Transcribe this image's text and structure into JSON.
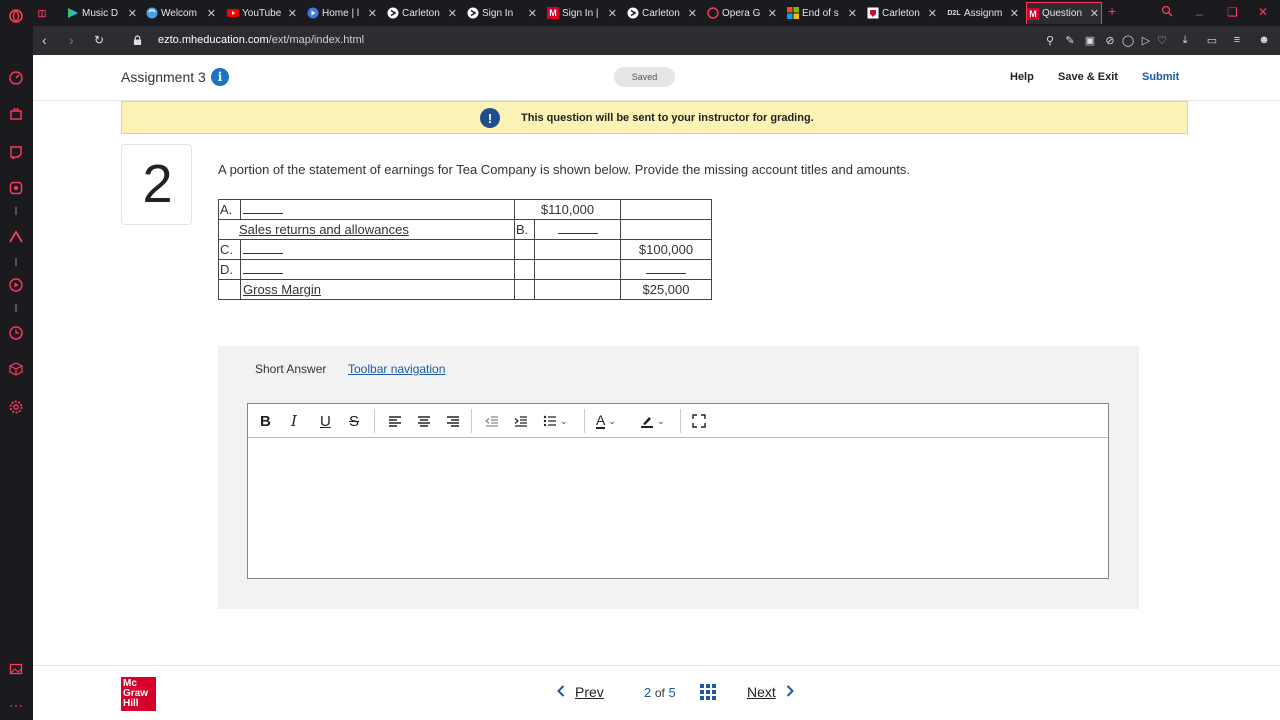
{
  "browser": {
    "tabs": [
      {
        "icon": "play-store-icon",
        "label": "Music D"
      },
      {
        "icon": "welcome-icon",
        "label": "Welcom"
      },
      {
        "icon": "youtube-icon",
        "label": "YouTube"
      },
      {
        "icon": "home-icon",
        "label": "Home | l"
      },
      {
        "icon": "carleton-icon",
        "label": "Carleton"
      },
      {
        "icon": "signin-icon",
        "label": "Sign In"
      },
      {
        "icon": "mheducation-icon",
        "label": "Sign In |"
      },
      {
        "icon": "carleton-icon",
        "label": "Carleton"
      },
      {
        "icon": "opera-gx-icon",
        "label": "Opera G"
      },
      {
        "icon": "microsoft-icon",
        "label": "End of s"
      },
      {
        "icon": "carleton-crest-icon",
        "label": "Carleton"
      },
      {
        "icon": "d2l-icon",
        "label": "Assignm"
      },
      {
        "icon": "mheducation-icon",
        "label": "Question"
      }
    ],
    "url_domain": "ezto.mheducation.com",
    "url_path": "/ext/map/index.html"
  },
  "header": {
    "assignment_title": "Assignment 3",
    "saved_label": "Saved",
    "help_label": "Help",
    "save_exit_label": "Save & Exit",
    "submit_label": "Submit"
  },
  "banner": {
    "text": "This question will be sent to your instructor for grading."
  },
  "question": {
    "number": "2",
    "prompt": "A portion of the statement of earnings for Tea Company is shown below. Provide the missing account titles and amounts.",
    "rows": [
      {
        "label": "A.",
        "name": "",
        "mid": "",
        "amount1": "$110,000",
        "amount2": ""
      },
      {
        "label": "",
        "name": "Sales returns and allowances",
        "mid": "B.",
        "amount1": "",
        "amount2": ""
      },
      {
        "label": "C.",
        "name": "",
        "mid": "",
        "amount1": "",
        "amount2": "$100,000"
      },
      {
        "label": "D.",
        "name": "",
        "mid": "",
        "amount1": "",
        "amount2": ""
      },
      {
        "label": "",
        "name": "Gross Margin",
        "mid": "",
        "amount1": "",
        "amount2": "$25,000"
      }
    ]
  },
  "answer": {
    "type_label": "Short Answer",
    "toolbar_nav_label": "Toolbar navigation",
    "toolbar": {
      "bold": "B",
      "italic": "I",
      "underline": "U",
      "strike": "S",
      "font_color": "A"
    }
  },
  "footer": {
    "logo_line1": "Mc",
    "logo_line2": "Graw",
    "logo_line3": "Hill",
    "prev_label": "Prev",
    "current_page": "2",
    "of_label": "of",
    "total_pages": "5",
    "next_label": "Next"
  },
  "colors": {
    "accent": "#1a5aa6",
    "opera_red": "#ff3b5c",
    "banner_bg": "#fbf3b5",
    "mgh_red": "#d6002a"
  }
}
